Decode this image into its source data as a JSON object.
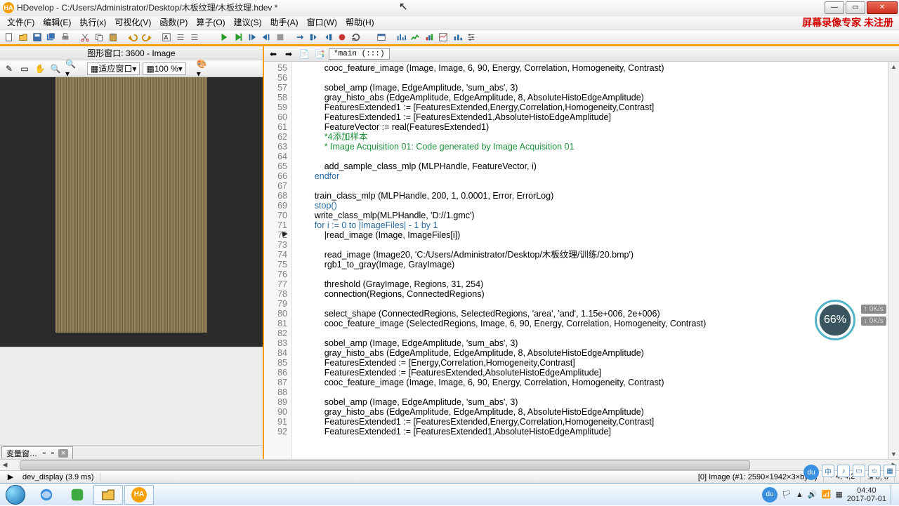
{
  "window": {
    "app_badge": "HA",
    "title": "HDevelop - C:/Users/Administrator/Desktop/木板纹理/木板纹理.hdev *",
    "min": "—",
    "max": "▭",
    "close": "✕"
  },
  "menu": {
    "items": [
      "文件(F)",
      "编辑(E)",
      "执行(x)",
      "可视化(V)",
      "函数(P)",
      "算子(O)",
      "建议(S)",
      "助手(A)",
      "窗口(W)",
      "帮助(H)"
    ],
    "watermark": "屏幕录像专家 未注册"
  },
  "left": {
    "header": "图形窗口: 3600 - Image",
    "fit_label": "适应窗口",
    "zoom_label": "100 %"
  },
  "var_tab": {
    "label": "变量窗…",
    "sq1": "▫",
    "sq2": "▫",
    "close": "×"
  },
  "code_tab": {
    "label": "*main (:::)"
  },
  "code": {
    "first_line": 55,
    "highlight_index": 17,
    "lines": [
      {
        "ind": 3,
        "seg": [
          {
            "t": "cooc_feature_image (Image, Image, 6, 90, Energy, Correlation, Homogeneity, Contrast)"
          }
        ]
      },
      {
        "ind": 3,
        "seg": []
      },
      {
        "ind": 3,
        "seg": [
          {
            "t": "sobel_amp (Image, EdgeAmplitude, 'sum_abs', 3)"
          }
        ]
      },
      {
        "ind": 3,
        "seg": [
          {
            "t": "gray_histo_abs (EdgeAmplitude, EdgeAmplitude, 8, AbsoluteHistoEdgeAmplitude)"
          }
        ]
      },
      {
        "ind": 3,
        "seg": [
          {
            "t": "FeaturesExtended1 := [FeaturesExtended,Energy,Correlation,Homogeneity,Contrast]"
          }
        ]
      },
      {
        "ind": 3,
        "seg": [
          {
            "t": "FeaturesExtended1 := [FeaturesExtended1,AbsoluteHistoEdgeAmplitude]"
          }
        ]
      },
      {
        "ind": 3,
        "seg": [
          {
            "t": "FeatureVector := real(FeaturesExtended1)"
          }
        ]
      },
      {
        "ind": 3,
        "seg": [
          {
            "t": "*4添加样本",
            "c": "c-cm"
          }
        ]
      },
      {
        "ind": 3,
        "seg": [
          {
            "t": "* Image Acquisition 01: Code generated by Image Acquisition 01",
            "c": "c-cm"
          }
        ]
      },
      {
        "ind": 3,
        "seg": []
      },
      {
        "ind": 3,
        "seg": [
          {
            "t": "add_sample_class_mlp (MLPHandle, FeatureVector, i)"
          }
        ]
      },
      {
        "ind": 2,
        "seg": [
          {
            "t": "endfor",
            "c": "c-kw"
          }
        ]
      },
      {
        "ind": 2,
        "seg": []
      },
      {
        "ind": 2,
        "seg": [
          {
            "t": "train_class_mlp (MLPHandle, 200, 1, 0.0001, Error, ErrorLog)"
          }
        ]
      },
      {
        "ind": 2,
        "seg": [
          {
            "t": "stop()",
            "c": "c-kw"
          }
        ]
      },
      {
        "ind": 2,
        "seg": [
          {
            "t": "write_class_mlp(MLPHandle, 'D://1.gmc')"
          }
        ]
      },
      {
        "ind": 2,
        "seg": [
          {
            "t": "for i := 0 to |ImageFiles| - 1 by 1",
            "c": "c-kw"
          }
        ]
      },
      {
        "ind": 3,
        "seg": [
          {
            "t": "|read_image (Image, ImageFiles[i])"
          }
        ]
      },
      {
        "ind": 3,
        "seg": []
      },
      {
        "ind": 3,
        "seg": [
          {
            "t": "read_image (Image20, 'C:/Users/Administrator/Desktop/木板纹理/训练/20.bmp')"
          }
        ]
      },
      {
        "ind": 3,
        "seg": [
          {
            "t": "rgb1_to_gray(Image, GrayImage)"
          }
        ]
      },
      {
        "ind": 3,
        "seg": []
      },
      {
        "ind": 3,
        "seg": [
          {
            "t": "threshold (GrayImage, Regions, 31, 254)"
          }
        ]
      },
      {
        "ind": 3,
        "seg": [
          {
            "t": "connection(Regions, ConnectedRegions)"
          }
        ]
      },
      {
        "ind": 3,
        "seg": []
      },
      {
        "ind": 3,
        "seg": [
          {
            "t": "select_shape (ConnectedRegions, SelectedRegions, 'area', 'and', 1.15e+006, 2e+006)"
          }
        ]
      },
      {
        "ind": 3,
        "seg": [
          {
            "t": "cooc_feature_image (SelectedRegions, Image, 6, 90, Energy, Correlation, Homogeneity, Contrast)"
          }
        ]
      },
      {
        "ind": 3,
        "seg": []
      },
      {
        "ind": 3,
        "seg": [
          {
            "t": "sobel_amp (Image, EdgeAmplitude, 'sum_abs', 3)"
          }
        ]
      },
      {
        "ind": 3,
        "seg": [
          {
            "t": "gray_histo_abs (EdgeAmplitude, EdgeAmplitude, 8, AbsoluteHistoEdgeAmplitude)"
          }
        ]
      },
      {
        "ind": 3,
        "seg": [
          {
            "t": "FeaturesExtended := [Energy,Correlation,Homogeneity,Contrast]"
          }
        ]
      },
      {
        "ind": 3,
        "seg": [
          {
            "t": "FeaturesExtended := [FeaturesExtended,AbsoluteHistoEdgeAmplitude]"
          }
        ]
      },
      {
        "ind": 3,
        "seg": [
          {
            "t": "cooc_feature_image (Image, Image, 6, 90, Energy, Correlation, Homogeneity, Contrast)"
          }
        ]
      },
      {
        "ind": 3,
        "seg": []
      },
      {
        "ind": 3,
        "seg": [
          {
            "t": "sobel_amp (Image, EdgeAmplitude, 'sum_abs', 3)"
          }
        ]
      },
      {
        "ind": 3,
        "seg": [
          {
            "t": "gray_histo_abs (EdgeAmplitude, EdgeAmplitude, 8, AbsoluteHistoEdgeAmplitude)"
          }
        ]
      },
      {
        "ind": 3,
        "seg": [
          {
            "t": "FeaturesExtended1 := [FeaturesExtended,Energy,Correlation,Homogeneity,Contrast]"
          }
        ]
      },
      {
        "ind": 3,
        "seg": [
          {
            "t": "FeaturesExtended1 := [FeaturesExtended1,AbsoluteHistoEdgeAmplitude]"
          }
        ]
      }
    ]
  },
  "status": {
    "left": "dev_display (3.9 ms)",
    "mid": "[0] Image (#1: 2590×1942×3×byte)",
    "coords": "4, 4,2",
    "zero": "0, 0"
  },
  "gauge": {
    "pct": "66%",
    "up": "0K/s",
    "down": "0K/s"
  },
  "side": {
    "du": "du",
    "cn": "中",
    "s1": "♪",
    "s2": "▭",
    "s3": "☺",
    "s4": "▦"
  },
  "tray": {
    "du": "du",
    "time": "04:40",
    "date": "2017-07-01"
  }
}
